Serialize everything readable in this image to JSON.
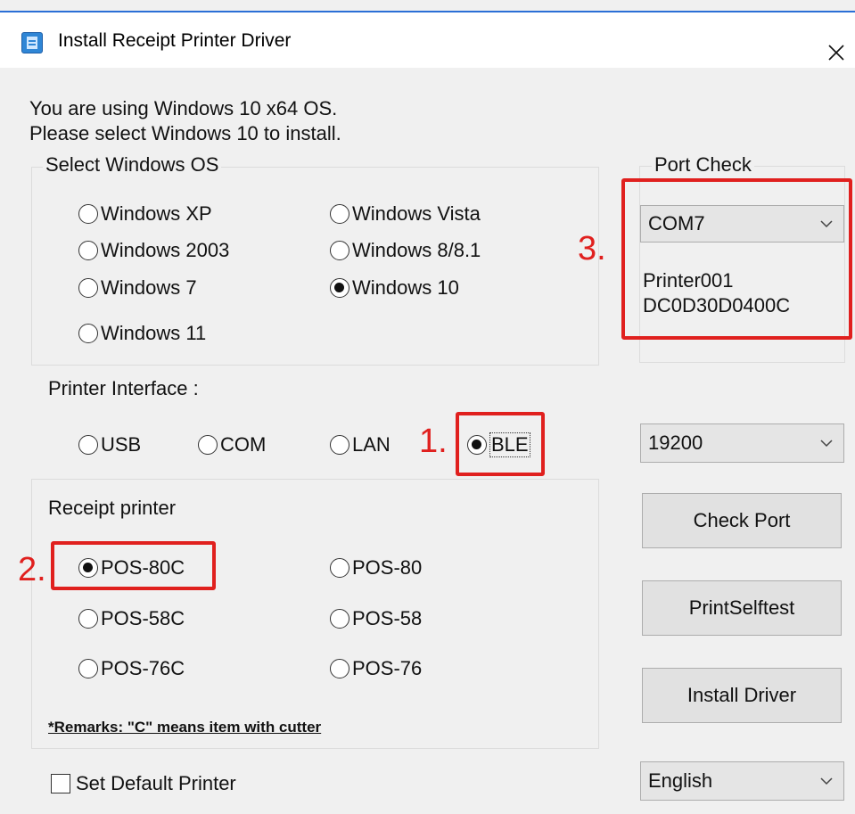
{
  "window": {
    "title": "Install Receipt Printer Driver",
    "close_icon": "close-icon"
  },
  "info": {
    "line1": "You are using Windows 10 x64 OS.",
    "line2": "Please select Windows 10 to install."
  },
  "os_group": {
    "legend": "Select Windows OS",
    "options": [
      {
        "label": "Windows XP",
        "checked": false
      },
      {
        "label": "Windows Vista",
        "checked": false
      },
      {
        "label": "Windows 2003",
        "checked": false
      },
      {
        "label": "Windows 8/8.1",
        "checked": false
      },
      {
        "label": "Windows 7",
        "checked": false
      },
      {
        "label": "Windows 10",
        "checked": true
      },
      {
        "label": "Windows 11",
        "checked": false
      }
    ]
  },
  "interface": {
    "label": "Printer Interface :",
    "options": [
      {
        "label": "USB",
        "checked": false
      },
      {
        "label": "COM",
        "checked": false
      },
      {
        "label": "LAN",
        "checked": false
      },
      {
        "label": "BLE",
        "checked": true
      }
    ]
  },
  "receipt_group": {
    "label": "Receipt printer",
    "options": [
      {
        "label": "POS-80C",
        "checked": true
      },
      {
        "label": "POS-80",
        "checked": false
      },
      {
        "label": "POS-58C",
        "checked": false
      },
      {
        "label": "POS-58",
        "checked": false
      },
      {
        "label": "POS-76C",
        "checked": false
      },
      {
        "label": "POS-76",
        "checked": false
      }
    ],
    "remarks": "*Remarks: \"C\" means item with cutter"
  },
  "port_check": {
    "legend": "Port Check",
    "port_value": "COM7",
    "device_name": "Printer001",
    "device_id": "DC0D30D0400C"
  },
  "baud": {
    "value": "19200"
  },
  "buttons": {
    "check_port": "Check Port",
    "print_selftest": "PrintSelftest",
    "install_driver": "Install Driver"
  },
  "default_printer": {
    "label": "Set Default Printer",
    "checked": false
  },
  "language": {
    "value": "English"
  },
  "annotations": {
    "one": "1.",
    "two": "2.",
    "three": "3.",
    "color": "#e0201e"
  }
}
